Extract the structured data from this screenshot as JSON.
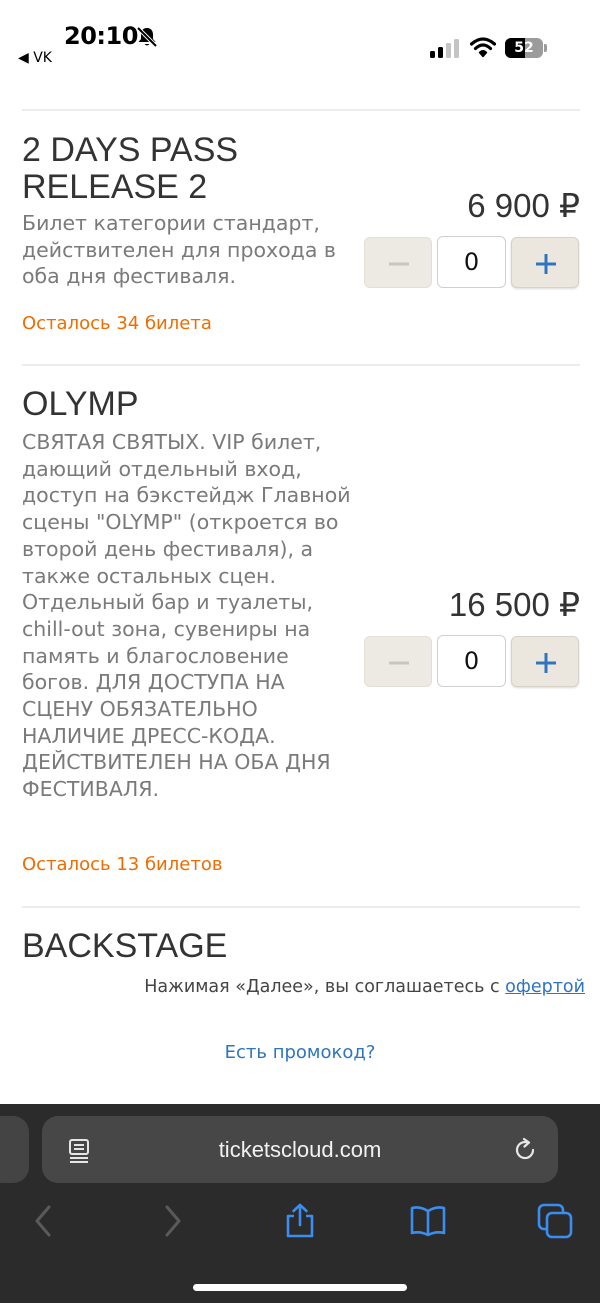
{
  "status_bar": {
    "time": "20:10",
    "back_app": "◀ VK",
    "battery_label": "52",
    "battery_level": 0.52
  },
  "tickets": [
    {
      "title": "2 DAYS PASS RELEASE 2",
      "description": "Билет категории стандарт, действителен для прохода в оба дня фестиваля.",
      "price": "6 900 ₽",
      "quantity": "0",
      "remaining": "Осталось 34 билета"
    },
    {
      "title": "OLYMP",
      "description": "СВЯТАЯ СВЯТЫХ. VIP билет, дающий отдельный вход, доступ на бэкстейдж Главной сцены \"OLYMP\" (откроется во второй день фестиваля), а также остальных сцен. Отдельный бар и туалеты, chill-out зона, сувениры на память и благословение богов. ДЛЯ ДОСТУПА НА СЦЕНУ ОБЯЗАТЕЛЬНО НАЛИЧИЕ ДРЕСС-КОДА. ДЕЙСТВИТЕЛЕН НА ОБА ДНЯ ФЕСТИВАЛЯ.",
      "price": "16 500 ₽",
      "quantity": "0",
      "remaining": "Осталось 13 билетов"
    },
    {
      "title": "BACKSTAGE"
    }
  ],
  "footer": {
    "agree_text": "Нажимая «Далее», вы соглашаетесь с ",
    "offer_link": "офертой",
    "promo_link": "Есть промокод?"
  },
  "browser": {
    "url": "ticketscloud.com"
  },
  "colors": {
    "accent_blue": "#2f74c0",
    "remaining_orange": "#ef6c00",
    "button_bg": "#edeae3",
    "safari_bar": "#2b2b2b"
  },
  "icons": [
    "bell-slash-icon",
    "cellular-signal-icon",
    "wifi-icon",
    "minus-icon",
    "plus-icon",
    "reader-mode-icon",
    "reload-icon",
    "back-arrow-icon",
    "forward-arrow-icon",
    "share-icon",
    "bookmarks-icon",
    "tabs-icon"
  ]
}
